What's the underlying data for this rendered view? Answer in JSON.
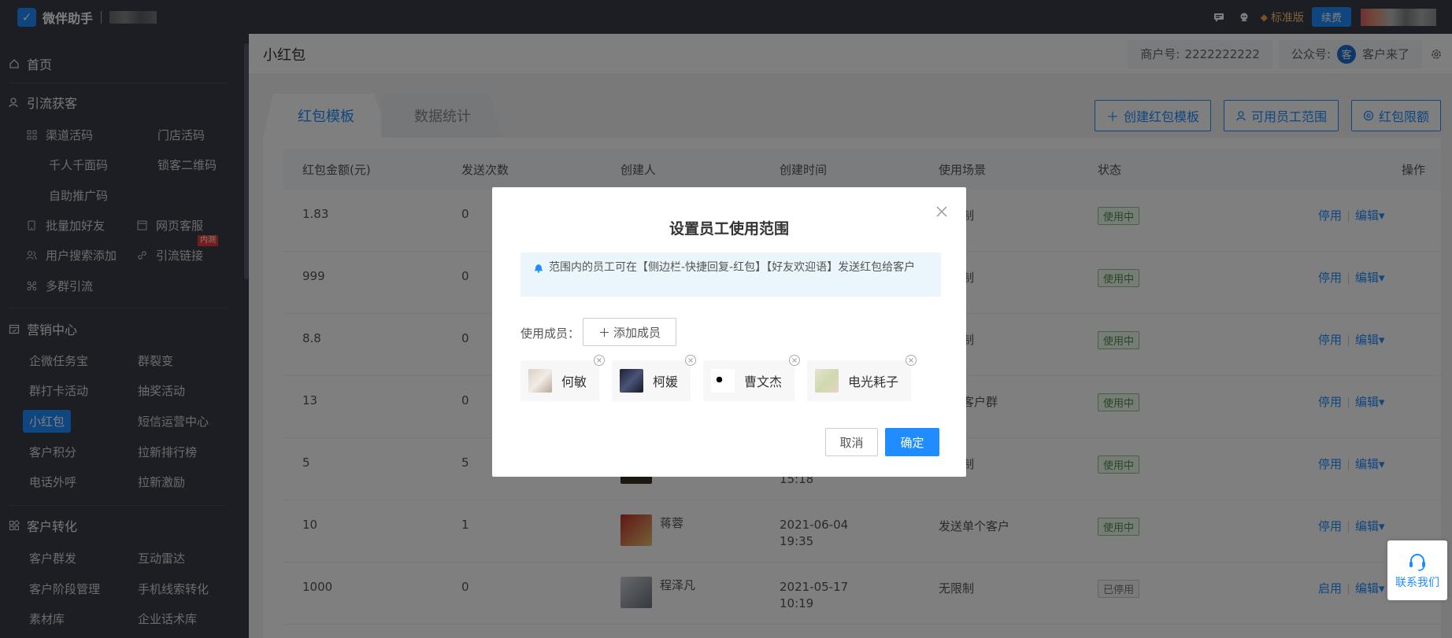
{
  "topbar": {
    "app_name": "微伴助手",
    "edition": "标准版",
    "renew": "续费"
  },
  "sidebar": {
    "home": "首页",
    "sections": [
      {
        "title": "引流获客",
        "items": [
          "渠道活码",
          "门店活码",
          "千人千面码",
          "锁客二维码",
          "自助推广码",
          "批量加好友",
          "网页客服",
          "用户搜索添加",
          "引流链接",
          "多群引流"
        ],
        "badge": "内测"
      },
      {
        "title": "营销中心",
        "items": [
          "企微任务宝",
          "群裂变",
          "群打卡活动",
          "抽奖活动",
          "小红包",
          "短信运营中心",
          "客户积分",
          "拉新排行榜",
          "电话外呼",
          "拉新激励"
        ]
      },
      {
        "title": "客户转化",
        "items": [
          "客户群发",
          "互动雷达",
          "客户阶段管理",
          "手机线索转化",
          "素材库",
          "企业话术库"
        ]
      }
    ]
  },
  "header": {
    "title": "小红包",
    "merchant_label": "商户号:",
    "merchant_no": "2222222222",
    "official_label": "公众号:",
    "official_avatar": "客",
    "official_name": "客户来了"
  },
  "tabs": [
    "红包模板",
    "数据统计"
  ],
  "actions": [
    "创建红包模板",
    "可用员工范围",
    "红包限额"
  ],
  "table": {
    "columns": [
      "红包金额(元)",
      "发送次数",
      "创建人",
      "创建时间",
      "使用场景",
      "状态",
      "操作"
    ],
    "rows": [
      {
        "amount": "1.83",
        "count": "0",
        "creator": "",
        "date": "",
        "time": "",
        "scene": "无限制",
        "status": "使用中",
        "op1": "停用",
        "op2": "编辑"
      },
      {
        "amount": "999",
        "count": "0",
        "creator": "",
        "date": "",
        "time": "",
        "scene": "无限制",
        "status": "使用中",
        "op1": "停用",
        "op2": "编辑"
      },
      {
        "amount": "8.8",
        "count": "0",
        "creator": "",
        "date": "",
        "time": "",
        "scene": "无限制",
        "status": "使用中",
        "op1": "停用",
        "op2": "编辑"
      },
      {
        "amount": "13",
        "count": "0",
        "creator": "",
        "date": "",
        "time": "",
        "scene": "发送客户群",
        "status": "使用中",
        "op1": "停用",
        "op2": "编辑"
      },
      {
        "amount": "5",
        "count": "5",
        "creator": "",
        "date": "",
        "time": "15:18",
        "scene": "无限制",
        "status": "使用中",
        "op1": "停用",
        "op2": "编辑"
      },
      {
        "amount": "10",
        "count": "1",
        "creator": "蒋蓉",
        "date": "2021-06-04",
        "time": "19:35",
        "scene": "发送单个客户",
        "status": "使用中",
        "op1": "停用",
        "op2": "编辑"
      },
      {
        "amount": "1000",
        "count": "0",
        "creator": "程泽凡",
        "date": "2021-05-17",
        "time": "10:19",
        "scene": "无限制",
        "status": "已停用",
        "op1": "启用",
        "op2": "编辑"
      }
    ]
  },
  "modal": {
    "title": "设置员工使用范围",
    "notice": "范围内的员工可在【侧边栏-快捷回复-红包】【好友欢迎语】发送红包给客户",
    "member_label": "使用成员：",
    "add_member": "添加成员",
    "members": [
      "何敏",
      "柯媛",
      "曹文杰",
      "电光耗子"
    ],
    "cancel": "取消",
    "confirm": "确定"
  },
  "contact": "联系我们",
  "colors": {
    "primary": "#1f8cff",
    "sidebar": "#393d49",
    "success": "#4a8f4a"
  }
}
